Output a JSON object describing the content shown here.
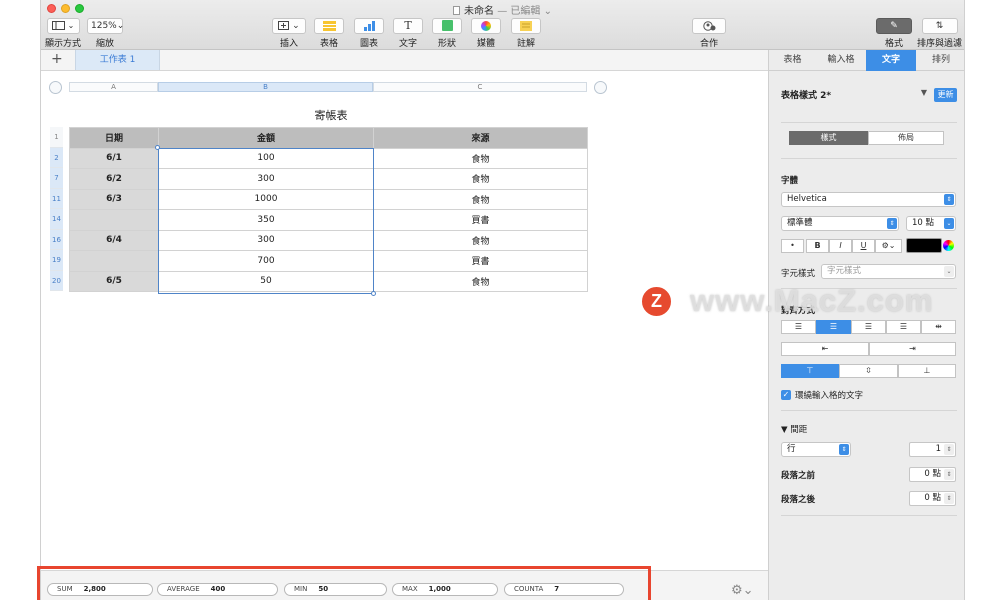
{
  "window": {
    "title": "未命名",
    "title_status": "— 已編輯 ⌄"
  },
  "toolbar": {
    "view_label": "顯示方式",
    "zoom_value": "125%",
    "zoom_label": "縮放",
    "insert_label": "插入",
    "table_label": "表格",
    "chart_label": "圖表",
    "text_label": "文字",
    "shape_label": "形狀",
    "media_label": "媒體",
    "comment_label": "註解",
    "collaborate_label": "合作",
    "format_label": "格式",
    "organize_label": "排序與過濾"
  },
  "tabs": {
    "add_symbol": "+",
    "sheet_name": "工作表 1"
  },
  "sheet": {
    "columns": [
      "A",
      "B",
      "C"
    ],
    "table_title": "寄帳表",
    "header": [
      "日期",
      "金額",
      "來源"
    ],
    "row_numbers": [
      "1",
      "2",
      "7",
      "11",
      "14",
      "16",
      "19",
      "20"
    ],
    "rows": [
      [
        "6/1",
        "100",
        "食物"
      ],
      [
        "6/2",
        "300",
        "食物"
      ],
      [
        "6/3",
        "1000",
        "食物"
      ],
      [
        "",
        "350",
        "買書"
      ],
      [
        "6/4",
        "300",
        "食物"
      ],
      [
        "",
        "700",
        "買書"
      ],
      [
        "6/5",
        "50",
        "食物"
      ]
    ]
  },
  "status": {
    "sum_label": "SUM",
    "sum_value": "2,800",
    "average_label": "AVERAGE",
    "average_value": "400",
    "min_label": "MIN",
    "min_value": "50",
    "max_label": "MAX",
    "max_value": "1,000",
    "counta_label": "COUNTA",
    "counta_value": "7"
  },
  "inspector": {
    "tabs": [
      "表格",
      "輸入格",
      "文字",
      "排列"
    ],
    "active_tab": "文字",
    "table_style": "表格樣式 2*",
    "update_label": "更新",
    "segment_style": "樣式",
    "segment_layout": "佈局",
    "font_heading": "字體",
    "font_family": "Helvetica",
    "font_typeface": "標準體",
    "font_size": "10 點",
    "style_buttons": [
      "•",
      "B",
      "I",
      "U",
      "⚙⌄"
    ],
    "char_style_label": "字元樣式",
    "char_style_value": "字元樣式",
    "alignment_heading": "對齊方式",
    "wrap_text_label": "環繞輸入格的文字",
    "spacing_heading": "間距",
    "spacing_mode": "行",
    "spacing_value": "1",
    "before_paragraph_label": "段落之前",
    "before_paragraph_value": "0 點",
    "after_paragraph_label": "段落之後",
    "after_paragraph_value": "0 點"
  },
  "watermark": {
    "logo_letter": "Z",
    "text": "www.MacZ.com"
  },
  "colors": {
    "accent_blue": "#3d8ee6",
    "highlight_red": "#e8452f",
    "header_gray": "#bdbdbd"
  }
}
